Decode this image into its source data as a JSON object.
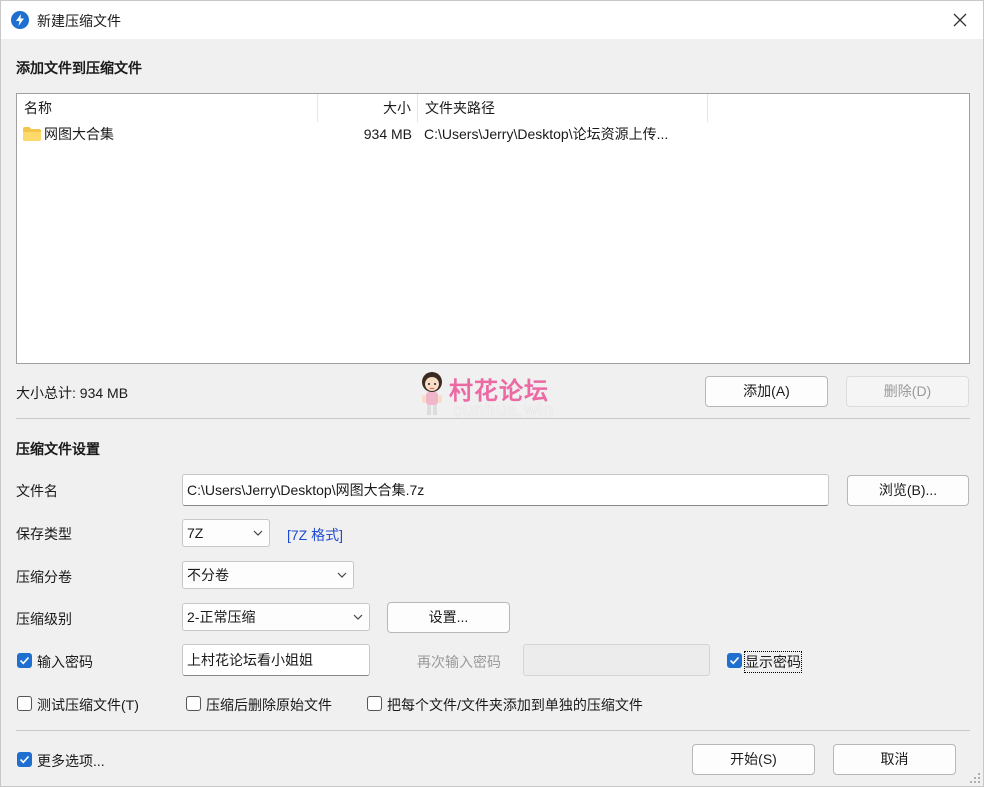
{
  "window": {
    "title": "新建压缩文件",
    "close_glyph": "✕"
  },
  "files_section": {
    "title": "添加文件到压缩文件",
    "columns": [
      "名称",
      "大小",
      "文件夹路径"
    ],
    "rows": [
      {
        "name": "网图大合集",
        "size": "934 MB",
        "path": "C:\\Users\\Jerry\\Desktop\\论坛资源上传...",
        "icon": "folder-icon"
      }
    ],
    "total_label": "大小总计: 934 MB",
    "add_button": "添加(A)",
    "delete_button": "删除(D)"
  },
  "watermark": {
    "title": "村花论坛",
    "subtitle": "cunhua.win"
  },
  "settings": {
    "title": "压缩文件设置",
    "filename_label": "文件名",
    "filename_value": "C:\\Users\\Jerry\\Desktop\\网图大合集.7z",
    "browse_button": "浏览(B)...",
    "type_label": "保存类型",
    "type_value": "7Z",
    "type_link": "[7Z 格式]",
    "split_label": "压缩分卷",
    "split_value": "不分卷",
    "level_label": "压缩级别",
    "level_value": "2-正常压缩",
    "settings_button": "设置...",
    "password_checkbox_label": "输入密码",
    "password_checked": true,
    "password_value": "上村花论坛看小姐姐",
    "reenter_label": "再次输入密码",
    "reenter_value": "",
    "show_password_label": "显示密码",
    "show_password_checked": true,
    "test_label": "测试压缩文件(T)",
    "test_checked": false,
    "delete_after_label": "压缩后删除原始文件",
    "delete_after_checked": false,
    "each_separate_label": "把每个文件/文件夹添加到单独的压缩文件",
    "each_separate_checked": false
  },
  "footer": {
    "more_options_label": "更多选项...",
    "more_options_checked": true,
    "start_button": "开始(S)",
    "cancel_button": "取消"
  },
  "colors": {
    "accent": "#1f6fd1",
    "link": "#1e4bd2",
    "watermark": "#ec6aa4"
  }
}
